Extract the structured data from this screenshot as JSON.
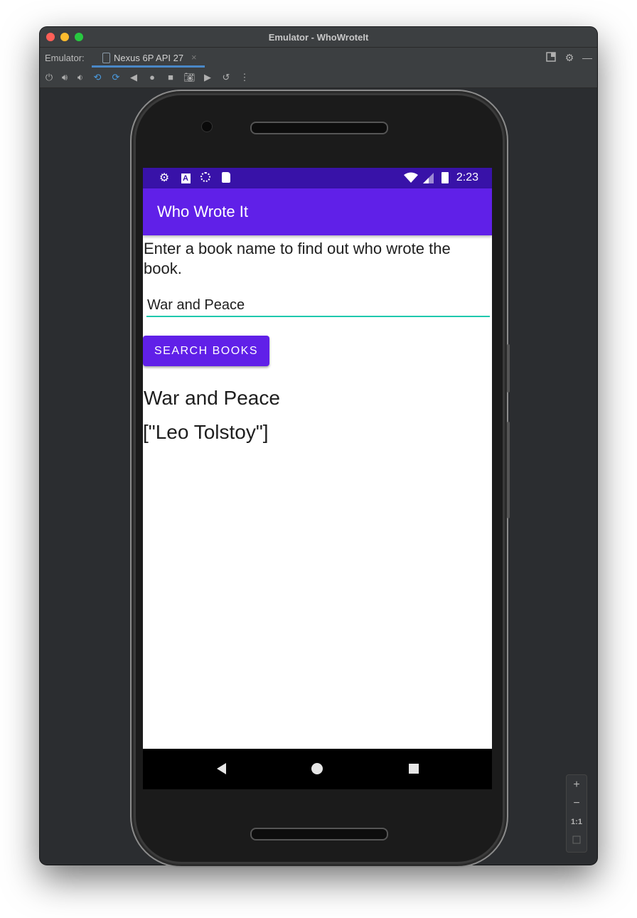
{
  "window": {
    "title": "Emulator - WhoWroteIt"
  },
  "tabbar": {
    "emulator_label": "Emulator:",
    "device_tab": "Nexus 6P API 27",
    "close_glyph": "×"
  },
  "toolbar": {
    "icons": [
      "power-icon",
      "volume-up-icon",
      "volume-down-icon",
      "rotate-left-icon",
      "rotate-right-icon",
      "back-icon",
      "home-icon",
      "overview-icon",
      "screenshot-icon",
      "screenrecord-icon",
      "snapshot-icon",
      "more-icon"
    ]
  },
  "status_bar": {
    "time": "2:23",
    "background": "#3812a8"
  },
  "app_bar": {
    "title": "Who Wrote It",
    "color": "#6020e8"
  },
  "main": {
    "prompt": "Enter a book name to find out who wrote the book.",
    "search_input_value": "War and Peace",
    "search_button_label": "SEARCH BOOKS",
    "result_title": "War and Peace",
    "result_authors": "[\"Leo Tolstoy\"]",
    "input_underline_color": "#1ec8ad"
  },
  "zoom_controls": {
    "zoom_in": "+",
    "zoom_out": "−",
    "actual_size": "1:1"
  }
}
